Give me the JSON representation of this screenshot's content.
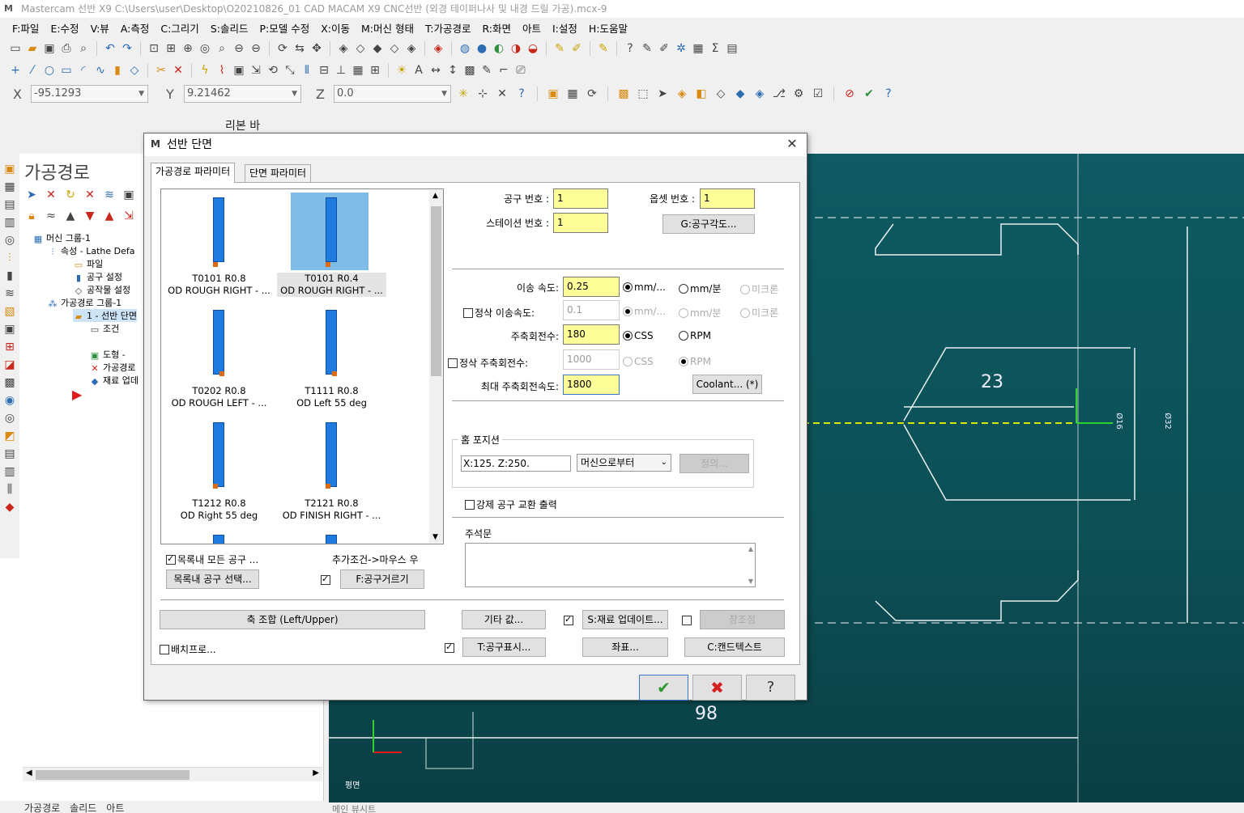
{
  "window": {
    "title": "Mastercam 선반 X9  C:\\Users\\user\\Desktop\\O20210826_01 CAD MACAM X9 CNC선반 (외경 테이퍼나사 및 내경 드릴 가공).mcx-9"
  },
  "menu": [
    "F:파일",
    "E:수정",
    "V:뷰",
    "A:측정",
    "C:그리기",
    "S:솔리드",
    "P:모델 수정",
    "X:이동",
    "M:머신 형태",
    "T:가공경로",
    "R:화면",
    "아트",
    "I:설정",
    "H:도움말"
  ],
  "coords": {
    "x_label": "X",
    "x_value": "-95.1293",
    "y_label": "Y",
    "y_value": "9.21462",
    "z_label": "Z",
    "z_value": "0.0"
  },
  "ribbon_label": "리본 바",
  "left_panel": {
    "title": "가공경로",
    "tree": [
      {
        "label": "머신 그룹-1"
      },
      {
        "label": "속성 - Lathe Defa"
      },
      {
        "label": "파일"
      },
      {
        "label": "공구 설정"
      },
      {
        "label": "공작물 설정"
      },
      {
        "label": "가공경로 그룹-1"
      },
      {
        "label": "1 - 선반 단면"
      },
      {
        "label": "조건"
      },
      {
        "label": "도형 -"
      },
      {
        "label": "가공경로"
      },
      {
        "label": "재료 업데"
      }
    ],
    "bottom_tabs": [
      "가공경로",
      "솔리드",
      "아트"
    ]
  },
  "graphics": {
    "dim_23": "23",
    "dim_98": "98",
    "dim_v1": "Ø16",
    "dim_v2": "Ø32",
    "view_label": "평면",
    "status_tab": "메인 뷰시트"
  },
  "dialog": {
    "title": "선반 단면",
    "tabs": [
      "가공경로 파라미터",
      "단면 파라미터"
    ],
    "tools": [
      {
        "line1": "T0101 R0.8",
        "line2": "OD ROUGH RIGHT - ..."
      },
      {
        "line1": "T0101 R0.4",
        "line2": "OD ROUGH RIGHT - ..."
      },
      {
        "line1": "T0202 R0.8",
        "line2": "OD ROUGH LEFT - ..."
      },
      {
        "line1": "T1111 R0.8",
        "line2": "OD Left 55 deg"
      },
      {
        "line1": "T1212 R0.8",
        "line2": "OD Right 55 deg"
      },
      {
        "line1": "T2121 R0.8",
        "line2": "OD FINISH RIGHT - ..."
      }
    ],
    "show_all_tools": "목록내 모든 공구 ...",
    "right_click_hint": "추가조건->마우스 우",
    "select_tool_btn": "목록내 공구 선택...",
    "tool_filter_btn": "F:공구거르기",
    "axis_combo_btn": "축 조합 (Left/Upper)",
    "batch": "배치프로...",
    "tool_number_label": "공구 번호 :",
    "tool_number": "1",
    "offset_number_label": "옵셋 번호 :",
    "offset_number": "1",
    "station_label": "스테이션 번호 :",
    "station_number": "1",
    "tool_angle_btn": "G:공구각도...",
    "feed_label": "이송 속도:",
    "feed_value": "0.25",
    "feed_units": [
      "mm/...",
      "mm/분",
      "미크론"
    ],
    "finish_feed_label": "정삭 이송속도:",
    "finish_feed_value": "0.1",
    "finish_feed_units": [
      "mm/...",
      "mm/분",
      "미크론"
    ],
    "spindle_label": "주축회전수:",
    "spindle_value": "180",
    "spindle_modes": [
      "CSS",
      "RPM"
    ],
    "finish_spindle_label": "정삭 주축회전수:",
    "finish_spindle_value": "1000",
    "finish_spindle_modes": [
      "CSS",
      "RPM"
    ],
    "max_spindle_label": "최대 주축회전속도:",
    "max_spindle_value": "1800",
    "coolant_btn": "Coolant... (*)",
    "home_group": "홈 포지션",
    "home_value": "X:125.  Z:250.",
    "home_from": "머신으로부터",
    "home_btn": "정의...",
    "force_tool_change": "강제 공구 교환 출력",
    "comment_label": "주석문",
    "misc_values_btn": "기타 값...",
    "stock_update_btn": "S:재료 업데이트...",
    "ref_points_btn": "참조점",
    "tool_display_btn": "T:공구표시...",
    "coords_btn": "좌표...",
    "canned_text_btn": "C:캔드텍스트"
  }
}
